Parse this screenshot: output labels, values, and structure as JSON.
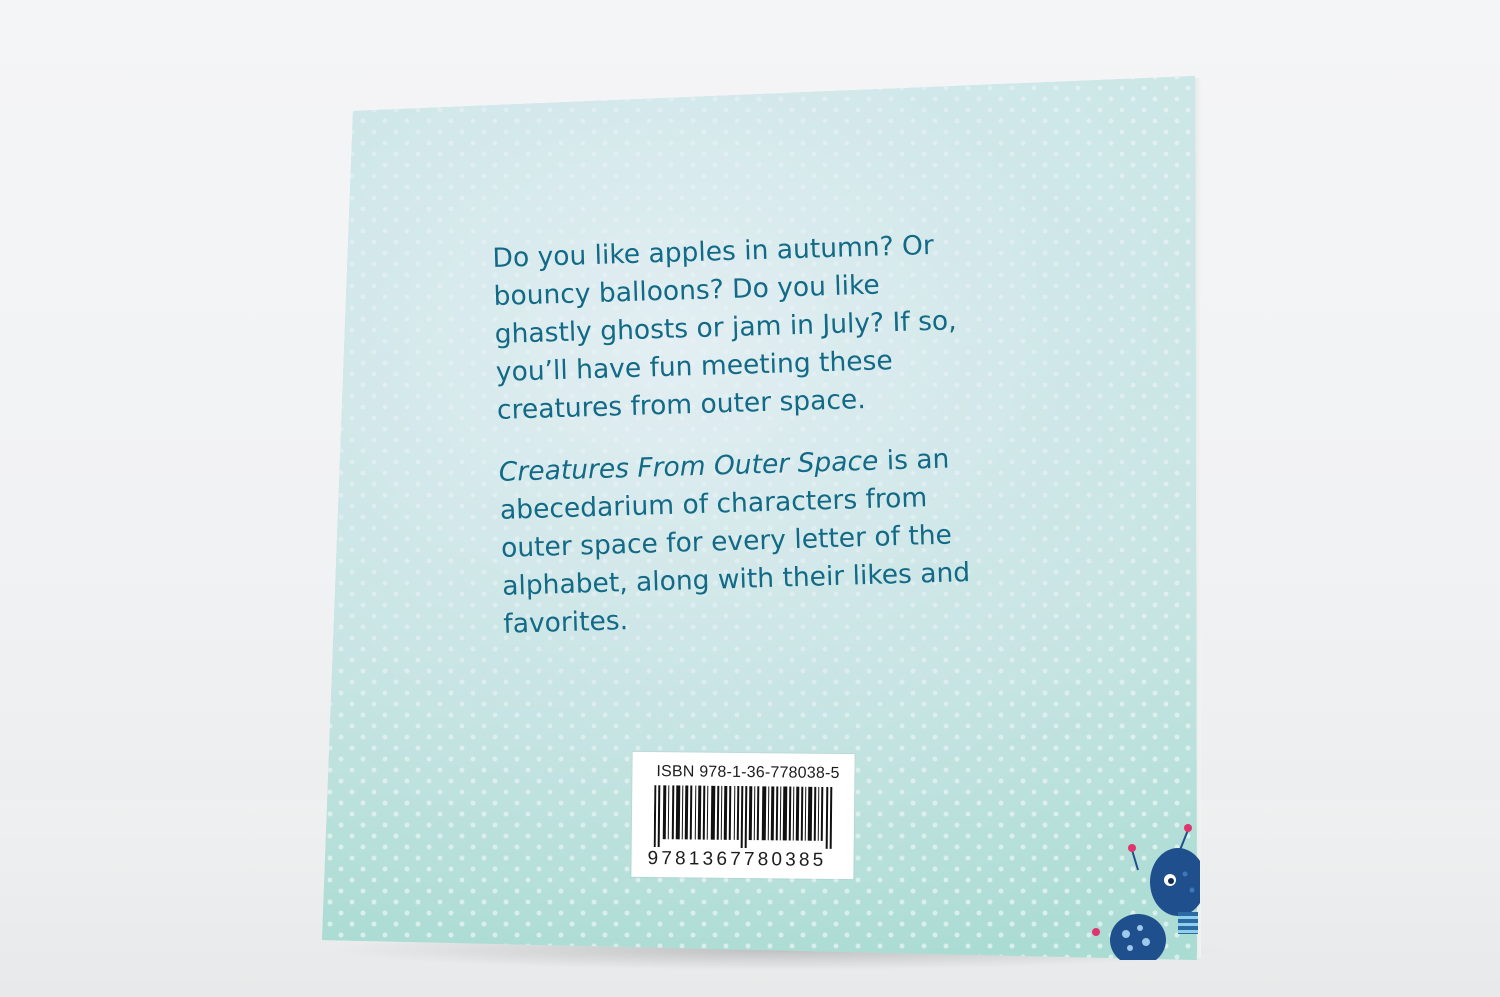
{
  "back_cover": {
    "blurb_paragraph_1": "Do you like apples in autumn? Or bouncy balloons? Do you like ghastly ghosts or jam in July? If so, you’ll have fun meeting these creatures from outer space.",
    "blurb_title_italic": "Creatures From Outer Space",
    "blurb_paragraph_2_rest": " is an abecedarium of characters from outer space for every letter of the alphabet, along with their likes and favorites."
  },
  "barcode": {
    "isbn_label": "ISBN 978-1-36-778038-5",
    "digits": "9781367780385"
  },
  "colors": {
    "cover_background": "#bfe4df",
    "text_color": "#126a86",
    "monster_blue": "#1f4f8c",
    "monster_pink": "#e0346e"
  },
  "icons": [
    "barcode-icon",
    "monster-illustration-icon"
  ]
}
